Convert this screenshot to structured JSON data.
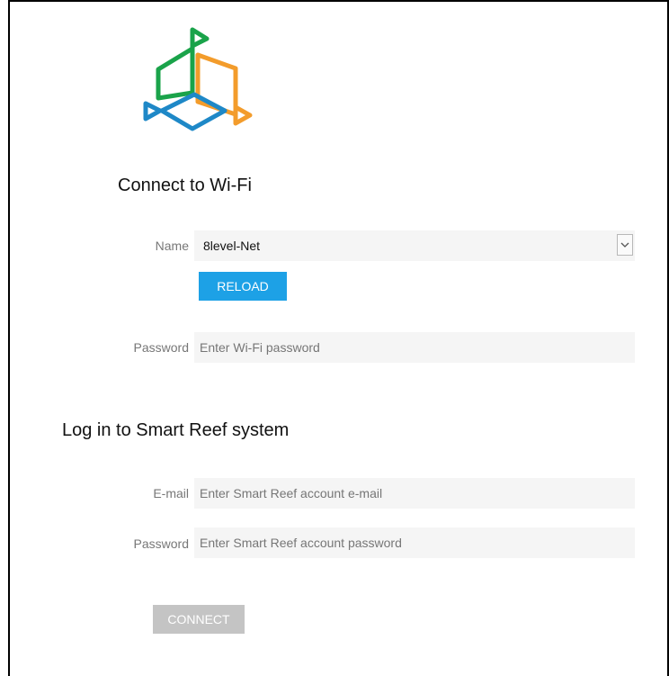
{
  "wifi": {
    "heading": "Connect to Wi-Fi",
    "name_label": "Name",
    "network_selected": "8level-Net",
    "reload_label": "RELOAD",
    "password_label": "Password",
    "password_placeholder": "Enter Wi-Fi password"
  },
  "login": {
    "heading": "Log in to Smart Reef system",
    "email_label": "E-mail",
    "email_placeholder": "Enter Smart Reef account e-mail",
    "password_label": "Password",
    "password_placeholder": "Enter Smart Reef account password",
    "connect_label": "CONNECT"
  },
  "colors": {
    "accent_blue": "#1da1e6",
    "logo_green": "#1aa34a",
    "logo_orange": "#f39c2b",
    "logo_blue": "#1e88c7",
    "disabled_gray": "#c4c4c4"
  }
}
